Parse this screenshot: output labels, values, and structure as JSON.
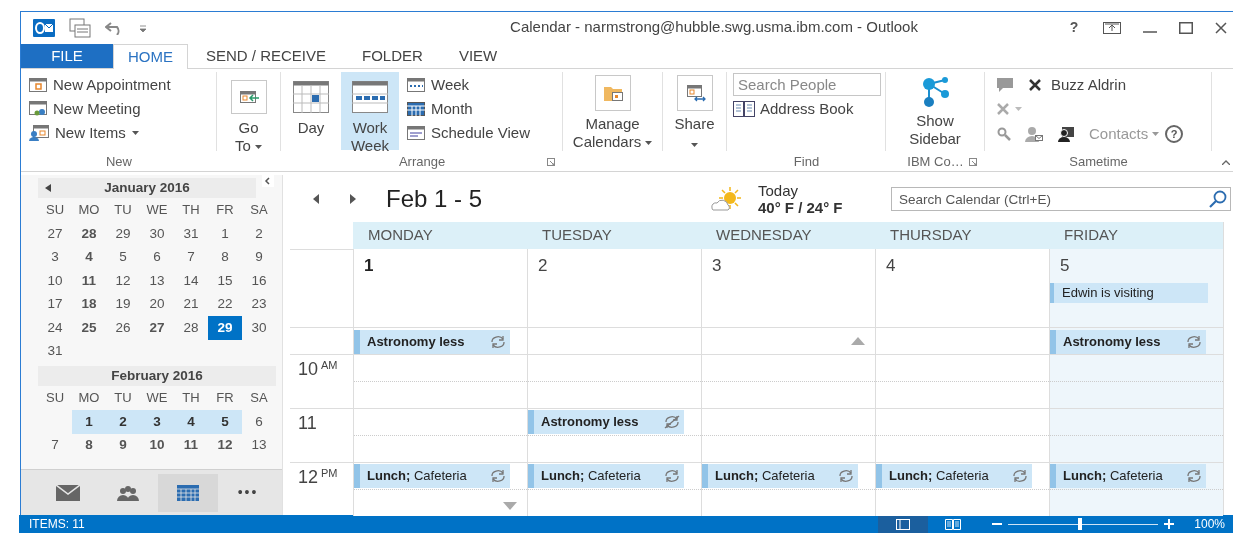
{
  "window": {
    "title": "Calendar - narmstrong@hubble.swg.usma.ibm.com - Outlook",
    "help": "?"
  },
  "tabs": [
    {
      "label": "FILE",
      "kind": "file",
      "selected": false
    },
    {
      "label": "HOME",
      "kind": "tab",
      "selected": true
    },
    {
      "label": "SEND / RECEIVE",
      "kind": "tab",
      "selected": false
    },
    {
      "label": "FOLDER",
      "kind": "tab",
      "selected": false
    },
    {
      "label": "VIEW",
      "kind": "tab",
      "selected": false
    }
  ],
  "ribbon": {
    "new": {
      "label": "New",
      "items": [
        {
          "label": "New Appointment",
          "dropdown": false
        },
        {
          "label": "New Meeting",
          "dropdown": false
        },
        {
          "label": "New Items",
          "dropdown": true
        }
      ]
    },
    "go_to": {
      "label": "Go To",
      "dropdown": true
    },
    "arrange": {
      "label": "Arrange",
      "views": [
        {
          "label": "Day",
          "selected": false
        },
        {
          "label": "Work Week",
          "selected": true
        },
        {
          "label": "Week",
          "selected": false
        },
        {
          "label": "Month",
          "selected": false
        },
        {
          "label": "Schedule View",
          "selected": false
        }
      ]
    },
    "manage_calendars": {
      "label": "Manage Calendars",
      "dropdown": true
    },
    "share": {
      "label": "Share",
      "dropdown": true
    },
    "find": {
      "label": "Find",
      "search": {
        "placeholder": "Search People"
      },
      "address_book": "Address Book"
    },
    "ibm": {
      "label": "IBM Co…",
      "show_sidebar": "Show Sidebar"
    },
    "sametime": {
      "label": "Sametime",
      "contact": {
        "label": "Buzz Aldrin",
        "disabled": false
      },
      "contacts": {
        "label": "Contacts",
        "disabled": true,
        "dropdown": true
      },
      "help": "?"
    }
  },
  "navigation": {
    "months": [
      {
        "title": "January 2016",
        "leading_blank": false,
        "weekdays": [
          "SU",
          "MO",
          "TU",
          "WE",
          "TH",
          "FR",
          "SA"
        ],
        "weeks": [
          [
            {
              "text": "27",
              "busy": false,
              "today": false,
              "selected": false
            },
            {
              "text": "28",
              "busy": true,
              "today": false,
              "selected": false
            },
            {
              "text": "29",
              "busy": false,
              "today": false,
              "selected": false
            },
            {
              "text": "30",
              "busy": false,
              "today": false,
              "selected": false
            },
            {
              "text": "31",
              "busy": false,
              "today": false,
              "selected": false
            },
            {
              "text": "1",
              "busy": false,
              "today": false,
              "selected": false
            },
            {
              "text": "2",
              "busy": false,
              "today": false,
              "selected": false
            }
          ],
          [
            {
              "text": "3",
              "busy": false,
              "today": false,
              "selected": false
            },
            {
              "text": "4",
              "busy": true,
              "today": false,
              "selected": false
            },
            {
              "text": "5",
              "busy": false,
              "today": false,
              "selected": false
            },
            {
              "text": "6",
              "busy": false,
              "today": false,
              "selected": false
            },
            {
              "text": "7",
              "busy": false,
              "today": false,
              "selected": false
            },
            {
              "text": "8",
              "busy": false,
              "today": false,
              "selected": false
            },
            {
              "text": "9",
              "busy": false,
              "today": false,
              "selected": false
            }
          ],
          [
            {
              "text": "10",
              "busy": false,
              "today": false,
              "selected": false
            },
            {
              "text": "11",
              "busy": true,
              "today": false,
              "selected": false
            },
            {
              "text": "12",
              "busy": false,
              "today": false,
              "selected": false
            },
            {
              "text": "13",
              "busy": false,
              "today": false,
              "selected": false
            },
            {
              "text": "14",
              "busy": false,
              "today": false,
              "selected": false
            },
            {
              "text": "15",
              "busy": false,
              "today": false,
              "selected": false
            },
            {
              "text": "16",
              "busy": false,
              "today": false,
              "selected": false
            }
          ],
          [
            {
              "text": "17",
              "busy": false,
              "today": false,
              "selected": false
            },
            {
              "text": "18",
              "busy": true,
              "today": false,
              "selected": false
            },
            {
              "text": "19",
              "busy": false,
              "today": false,
              "selected": false
            },
            {
              "text": "20",
              "busy": false,
              "today": false,
              "selected": false
            },
            {
              "text": "21",
              "busy": false,
              "today": false,
              "selected": false
            },
            {
              "text": "22",
              "busy": false,
              "today": false,
              "selected": false
            },
            {
              "text": "23",
              "busy": false,
              "today": false,
              "selected": false
            }
          ],
          [
            {
              "text": "24",
              "busy": false,
              "today": false,
              "selected": false
            },
            {
              "text": "25",
              "busy": true,
              "today": false,
              "selected": false
            },
            {
              "text": "26",
              "busy": false,
              "today": false,
              "selected": false
            },
            {
              "text": "27",
              "busy": true,
              "today": false,
              "selected": false
            },
            {
              "text": "28",
              "busy": false,
              "today": false,
              "selected": false
            },
            {
              "text": "29",
              "busy": true,
              "today": true,
              "selected": false
            },
            {
              "text": "30",
              "busy": false,
              "today": false,
              "selected": false
            }
          ],
          [
            {
              "text": "31",
              "busy": false,
              "today": false,
              "selected": false
            }
          ]
        ]
      },
      {
        "title": "February 2016",
        "leading_blank": true,
        "weekdays": [
          "SU",
          "MO",
          "TU",
          "WE",
          "TH",
          "FR",
          "SA"
        ],
        "weeks": [
          [
            {
              "text": "1",
              "busy": true,
              "today": false,
              "selected": true
            },
            {
              "text": "2",
              "busy": true,
              "today": false,
              "selected": true
            },
            {
              "text": "3",
              "busy": true,
              "today": false,
              "selected": true
            },
            {
              "text": "4",
              "busy": true,
              "today": false,
              "selected": true
            },
            {
              "text": "5",
              "busy": true,
              "today": false,
              "selected": true
            },
            {
              "text": "6",
              "busy": false,
              "today": false,
              "selected": false
            }
          ],
          [
            {
              "text": "7",
              "busy": false,
              "today": false,
              "selected": false
            },
            {
              "text": "8",
              "busy": true,
              "today": false,
              "selected": false
            },
            {
              "text": "9",
              "busy": true,
              "today": false,
              "selected": false
            },
            {
              "text": "10",
              "busy": true,
              "today": false,
              "selected": false
            },
            {
              "text": "11",
              "busy": true,
              "today": false,
              "selected": false
            },
            {
              "text": "12",
              "busy": true,
              "today": false,
              "selected": false
            },
            {
              "text": "13",
              "busy": false,
              "today": false,
              "selected": false
            }
          ]
        ]
      }
    ],
    "nav_bar": [
      {
        "kind": "mail",
        "selected": false
      },
      {
        "kind": "people",
        "selected": false
      },
      {
        "kind": "calendar",
        "selected": true
      },
      {
        "kind": "more",
        "text": "•••",
        "selected": false
      }
    ]
  },
  "calendar": {
    "title": "Feb 1 - 5",
    "weather": {
      "label": "Today",
      "temps": "40° F / 24° F"
    },
    "search": {
      "placeholder": "Search Calendar (Ctrl+E)"
    },
    "days": [
      {
        "name": "MONDAY",
        "date": "1",
        "current": true,
        "selected": false
      },
      {
        "name": "TUESDAY",
        "date": "2",
        "current": false,
        "selected": false
      },
      {
        "name": "WEDNESDAY",
        "date": "3",
        "current": false,
        "selected": false
      },
      {
        "name": "THURSDAY",
        "date": "4",
        "current": false,
        "selected": false
      },
      {
        "name": "FRIDAY",
        "date": "5",
        "current": false,
        "selected": true,
        "all_day": [
          {
            "text": "Edwin is visiting"
          }
        ]
      }
    ],
    "slots": [
      {
        "cells": [
          {
            "more_above": false,
            "events": [
              {
                "text": "**Astronomy less**",
                "recurring": true,
                "exception": false
              }
            ]
          },
          {
            "more_above": false
          },
          {
            "more_above": true
          },
          {
            "more_above": false
          },
          {
            "more_above": false,
            "events": [
              {
                "text": "**Astronomy less**",
                "recurring": true,
                "exception": false
              }
            ]
          }
        ]
      },
      {
        "hour": "10",
        "suffix": "AM",
        "cells": [
          {},
          {},
          {},
          {},
          {}
        ]
      },
      {
        "hour": "11",
        "cells": [
          {},
          {
            "events": [
              {
                "text": "**Astronomy less**",
                "recurring": true,
                "exception": true
              }
            ]
          },
          {},
          {},
          {}
        ]
      },
      {
        "hour": "12",
        "suffix": "PM",
        "cells": [
          {
            "more_below": true,
            "events": [
              {
                "text": "**Lunch;** Cafeteria",
                "recurring": true,
                "exception": false
              }
            ]
          },
          {
            "more_below": false,
            "events": [
              {
                "text": "**Lunch;** Cafeteria",
                "recurring": true,
                "exception": false
              }
            ]
          },
          {
            "more_below": false,
            "events": [
              {
                "text": "**Lunch;** Cafeteria",
                "recurring": true,
                "exception": false
              }
            ]
          },
          {
            "more_below": false,
            "events": [
              {
                "text": "**Lunch;** Cafeteria",
                "recurring": true,
                "exception": false
              }
            ]
          },
          {
            "more_below": false,
            "events": [
              {
                "text": "**Lunch;** Cafeteria",
                "recurring": true,
                "exception": false
              }
            ]
          }
        ]
      }
    ]
  },
  "status_bar": {
    "items": "ITEMS: 11",
    "views": [
      {
        "kind": "normal",
        "selected": true
      },
      {
        "kind": "reading",
        "selected": false
      }
    ],
    "zoom": {
      "level": 0.48
    },
    "zoom_text": "100%"
  }
}
